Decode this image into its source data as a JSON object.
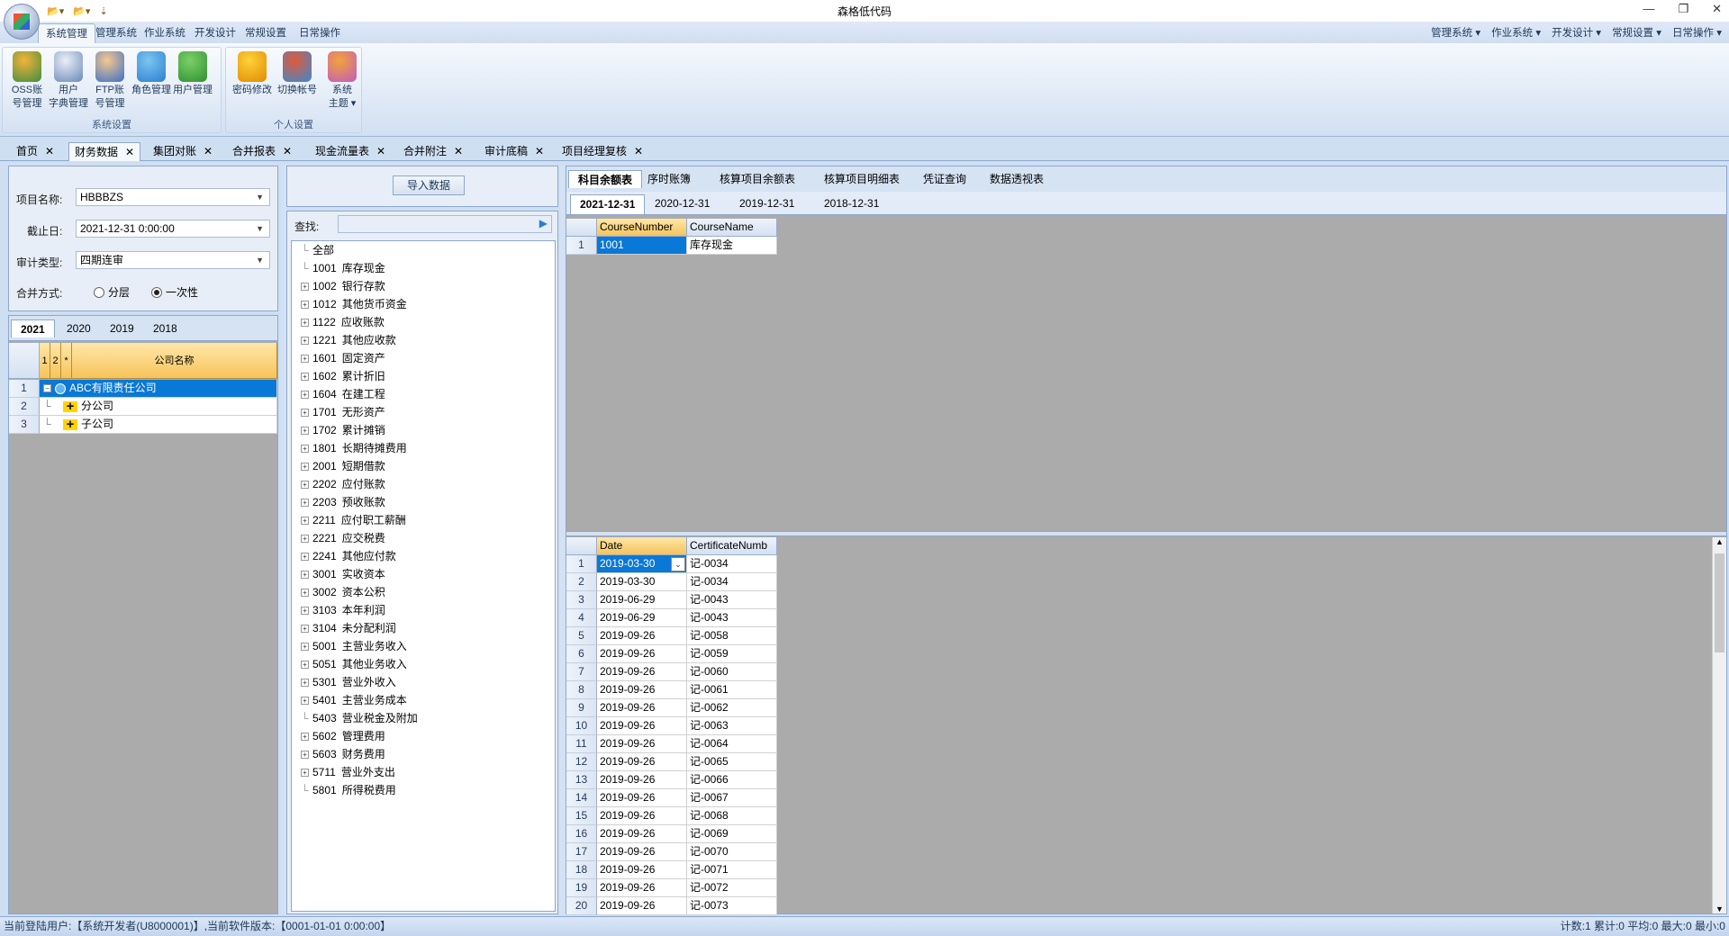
{
  "window": {
    "title": "森格低代码"
  },
  "qat": {
    "open1": "📂▾",
    "open2": "📂▾",
    "more": "⇣"
  },
  "ribbon": {
    "tabs": [
      "系统管理",
      "管理系统",
      "作业系统",
      "开发设计",
      "常规设置",
      "日常操作"
    ],
    "active_tab": 0,
    "right_menu": [
      "管理系统 ▾",
      "作业系统 ▾",
      "开发设计 ▾",
      "常规设置 ▾",
      "日常操作 ▾"
    ],
    "groups": [
      {
        "caption": "系统设置",
        "buttons": [
          {
            "l1": "OSS账",
            "l2": "号管理",
            "icon": "oss-icon",
            "c1": "#f4b23c",
            "c2": "#3d8e3d"
          },
          {
            "l1": "用户",
            "l2": "字典管理",
            "icon": "dictionary-icon",
            "c1": "#eaeff7",
            "c2": "#6a88b8"
          },
          {
            "l1": "FTP账",
            "l2": "号管理",
            "icon": "ftp-user-icon",
            "c1": "#f6c88f",
            "c2": "#3a6fc8"
          },
          {
            "l1": "角色管理",
            "l2": "",
            "icon": "role-icon",
            "c1": "#7cc5f0",
            "c2": "#2a7fd0"
          },
          {
            "l1": "用户管理",
            "l2": "",
            "icon": "user-add-icon",
            "c1": "#7ad06a",
            "c2": "#2f8f2f"
          }
        ]
      },
      {
        "caption": "个人设置",
        "buttons": [
          {
            "l1": "密码修改",
            "l2": "",
            "icon": "key-icon",
            "c1": "#ffd23a",
            "c2": "#e08a00"
          },
          {
            "l1": "切换帐号",
            "l2": "",
            "icon": "switch-user-icon",
            "c1": "#e05a3a",
            "c2": "#3a8ad0"
          },
          {
            "l1": "系统",
            "l2": "主题 ▾",
            "icon": "palette-icon",
            "c1": "#f5a23a",
            "c2": "#c05ac0"
          }
        ]
      }
    ]
  },
  "doc_tabs": [
    "首页",
    "财务数据",
    "集团对账",
    "合并报表",
    "现金流量表",
    "合并附注",
    "审计底稿",
    "项目经理复核"
  ],
  "active_doc_tab": 1,
  "left": {
    "form": {
      "project_label": "项目名称:",
      "project_value": "HBBBZS",
      "date_label": "截止日:",
      "date_value": "2021-12-31 0:00:00",
      "audit_label": "审计类型:",
      "audit_value": "四期连审",
      "merge_label": "合并方式:",
      "merge_opt1": "分层",
      "merge_opt2": "一次性",
      "merge_selected": 2
    },
    "year_tabs": [
      "2021",
      "2020",
      "2019",
      "2018"
    ],
    "company_grid": {
      "headers": [
        "1",
        "2",
        "*",
        "公司名称"
      ],
      "rows": [
        {
          "num": "1",
          "name": "ABC有限责任公司",
          "selected": true
        },
        {
          "num": "2",
          "name": "分公司",
          "selected": false
        },
        {
          "num": "3",
          "name": "子公司",
          "selected": false
        }
      ]
    }
  },
  "middle": {
    "import_button": "导入数据",
    "search_label": "查找:",
    "search_value": "",
    "tree": [
      {
        "code": "",
        "name": "全部",
        "expand": false
      },
      {
        "code": "1001",
        "name": "库存现金",
        "expand": false
      },
      {
        "code": "1002",
        "name": "银行存款",
        "expand": true
      },
      {
        "code": "1012",
        "name": "其他货币资金",
        "expand": true
      },
      {
        "code": "1122",
        "name": "应收账款",
        "expand": true
      },
      {
        "code": "1221",
        "name": "其他应收款",
        "expand": true
      },
      {
        "code": "1601",
        "name": "固定资产",
        "expand": true
      },
      {
        "code": "1602",
        "name": "累计折旧",
        "expand": true
      },
      {
        "code": "1604",
        "name": "在建工程",
        "expand": true
      },
      {
        "code": "1701",
        "name": "无形资产",
        "expand": true
      },
      {
        "code": "1702",
        "name": "累计摊销",
        "expand": true
      },
      {
        "code": "1801",
        "name": "长期待摊费用",
        "expand": true
      },
      {
        "code": "2001",
        "name": "短期借款",
        "expand": true
      },
      {
        "code": "2202",
        "name": "应付账款",
        "expand": true
      },
      {
        "code": "2203",
        "name": "预收账款",
        "expand": true
      },
      {
        "code": "2211",
        "name": "应付职工薪酬",
        "expand": true
      },
      {
        "code": "2221",
        "name": "应交税费",
        "expand": true
      },
      {
        "code": "2241",
        "name": "其他应付款",
        "expand": true
      },
      {
        "code": "3001",
        "name": "实收资本",
        "expand": true
      },
      {
        "code": "3002",
        "name": "资本公积",
        "expand": true
      },
      {
        "code": "3103",
        "name": "本年利润",
        "expand": true
      },
      {
        "code": "3104",
        "name": "未分配利润",
        "expand": true
      },
      {
        "code": "5001",
        "name": "主营业务收入",
        "expand": true
      },
      {
        "code": "5051",
        "name": "其他业务收入",
        "expand": true
      },
      {
        "code": "5301",
        "name": "营业外收入",
        "expand": true
      },
      {
        "code": "5401",
        "name": "主营业务成本",
        "expand": true
      },
      {
        "code": "5403",
        "name": "营业税金及附加",
        "expand": false
      },
      {
        "code": "5602",
        "name": "管理费用",
        "expand": true
      },
      {
        "code": "5603",
        "name": "财务费用",
        "expand": true
      },
      {
        "code": "5711",
        "name": "营业外支出",
        "expand": true
      },
      {
        "code": "5801",
        "name": "所得税费用",
        "expand": false
      }
    ]
  },
  "right": {
    "tabs": [
      "科目余额表",
      "序时账簿",
      "核算项目余额表",
      "核算项目明细表",
      "凭证查询",
      "数据透视表"
    ],
    "active_tab": 0,
    "date_tabs": [
      "2021-12-31",
      "2020-12-31",
      "2019-12-31",
      "2018-12-31"
    ],
    "active_date_tab": 0,
    "top_grid": {
      "headers": [
        "CourseNumber",
        "CourseName"
      ],
      "rows": [
        {
          "num": "1",
          "c1": "1001",
          "c2": "库存现金"
        }
      ]
    },
    "bottom_grid": {
      "headers": [
        "Date",
        "CertificateNumb"
      ],
      "rows": [
        {
          "num": "1",
          "c1": "2019-03-30",
          "c2": "记-0034"
        },
        {
          "num": "2",
          "c1": "2019-03-30",
          "c2": "记-0034"
        },
        {
          "num": "3",
          "c1": "2019-06-29",
          "c2": "记-0043"
        },
        {
          "num": "4",
          "c1": "2019-06-29",
          "c2": "记-0043"
        },
        {
          "num": "5",
          "c1": "2019-09-26",
          "c2": "记-0058"
        },
        {
          "num": "6",
          "c1": "2019-09-26",
          "c2": "记-0059"
        },
        {
          "num": "7",
          "c1": "2019-09-26",
          "c2": "记-0060"
        },
        {
          "num": "8",
          "c1": "2019-09-26",
          "c2": "记-0061"
        },
        {
          "num": "9",
          "c1": "2019-09-26",
          "c2": "记-0062"
        },
        {
          "num": "10",
          "c1": "2019-09-26",
          "c2": "记-0063"
        },
        {
          "num": "11",
          "c1": "2019-09-26",
          "c2": "记-0064"
        },
        {
          "num": "12",
          "c1": "2019-09-26",
          "c2": "记-0065"
        },
        {
          "num": "13",
          "c1": "2019-09-26",
          "c2": "记-0066"
        },
        {
          "num": "14",
          "c1": "2019-09-26",
          "c2": "记-0067"
        },
        {
          "num": "15",
          "c1": "2019-09-26",
          "c2": "记-0068"
        },
        {
          "num": "16",
          "c1": "2019-09-26",
          "c2": "记-0069"
        },
        {
          "num": "17",
          "c1": "2019-09-26",
          "c2": "记-0070"
        },
        {
          "num": "18",
          "c1": "2019-09-26",
          "c2": "记-0071"
        },
        {
          "num": "19",
          "c1": "2019-09-26",
          "c2": "记-0072"
        },
        {
          "num": "20",
          "c1": "2019-09-26",
          "c2": "记-0073"
        }
      ]
    }
  },
  "status": {
    "left": "当前登陆用户:【系统开发者(U8000001)】,当前软件版本:【0001-01-01 0:00:00】",
    "right": "计数:1 累计:0 平均:0 最大:0 最小:0"
  }
}
